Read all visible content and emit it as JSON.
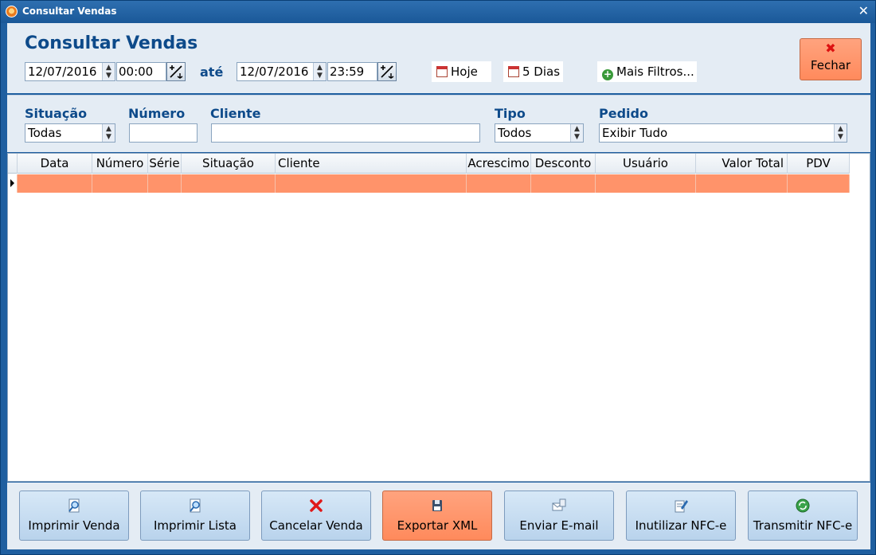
{
  "window": {
    "title": "Consultar Vendas"
  },
  "header": {
    "title": "Consultar Vendas",
    "date_from": "12/07/2016",
    "time_from": "00:00",
    "ate_label": "até",
    "date_to": "12/07/2016",
    "time_to": "23:59",
    "hoje_label": "Hoje",
    "cinco_dias_label": "5 Dias",
    "mais_filtros_label": "Mais Filtros...",
    "fechar_label": "Fechar"
  },
  "filters": {
    "situacao_label": "Situação",
    "situacao_value": "Todas",
    "numero_label": "Número",
    "numero_value": "",
    "cliente_label": "Cliente",
    "cliente_value": "",
    "tipo_label": "Tipo",
    "tipo_value": "Todos",
    "pedido_label": "Pedido",
    "pedido_value": "Exibir Tudo"
  },
  "grid": {
    "columns": [
      "Data",
      "Número",
      "Série",
      "Situação",
      "Cliente",
      "Acrescimo",
      "Desconto",
      "Usuário",
      "Valor Total",
      "PDV"
    ]
  },
  "actions": {
    "imprimir_venda": "Imprimir Venda",
    "imprimir_lista": "Imprimir Lista",
    "cancelar_venda": "Cancelar Venda",
    "exportar_xml": "Exportar XML",
    "enviar_email": "Enviar E-mail",
    "inutilizar_nfce": "Inutilizar NFC-e",
    "transmitir_nfce": "Transmitir NFC-e"
  },
  "colors": {
    "accent": "#ff936a",
    "title_blue": "#0d4a8a",
    "window_blue": "#1f5fa0"
  }
}
